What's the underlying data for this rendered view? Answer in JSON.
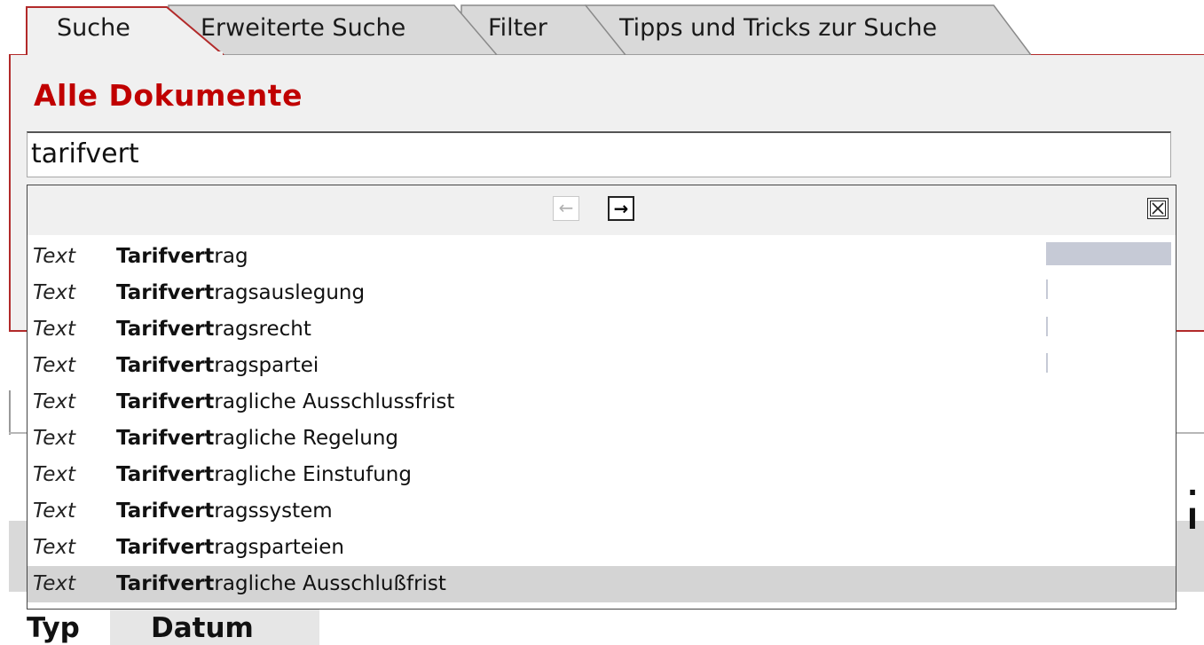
{
  "tabs": [
    {
      "label": "Suche",
      "active": true
    },
    {
      "label": "Erweiterte Suche",
      "active": false
    },
    {
      "label": "Filter",
      "active": false
    },
    {
      "label": "Tipps und Tricks zur Suche",
      "active": false
    }
  ],
  "panel": {
    "title": "Alle Dokumente",
    "search_value": "tarifvert"
  },
  "autocomplete": {
    "prev_glyph": "←",
    "next_glyph": "→",
    "match_prefix": "Tarifvert",
    "items": [
      {
        "type": "Text",
        "prefix": "Tarifvert",
        "suffix": "rag"
      },
      {
        "type": "Text",
        "prefix": "Tarifvert",
        "suffix": "ragsauslegung"
      },
      {
        "type": "Text",
        "prefix": "Tarifvert",
        "suffix": "ragsrecht"
      },
      {
        "type": "Text",
        "prefix": "Tarifvert",
        "suffix": "ragspartei"
      },
      {
        "type": "Text",
        "prefix": "Tarifvert",
        "suffix": "ragliche Ausschlussfrist"
      },
      {
        "type": "Text",
        "prefix": "Tarifvert",
        "suffix": "ragliche Regelung"
      },
      {
        "type": "Text",
        "prefix": "Tarifvert",
        "suffix": "ragliche Einstufung"
      },
      {
        "type": "Text",
        "prefix": "Tarifvert",
        "suffix": "ragssystem"
      },
      {
        "type": "Text",
        "prefix": "Tarifvert",
        "suffix": "ragsparteien"
      },
      {
        "type": "Text",
        "prefix": "Tarifvert",
        "suffix": "ragliche Ausschlußfrist",
        "selected": true
      }
    ]
  },
  "results": {
    "right_fragment": ". I",
    "columns": [
      "Typ",
      "Datum"
    ]
  },
  "colors": {
    "accent_red": "#c00000",
    "border_red": "#b22a2a",
    "panel_bg": "#f0f0f0",
    "selected_row": "#d4d4d4",
    "scroll_thumb": "#c6cad6"
  }
}
